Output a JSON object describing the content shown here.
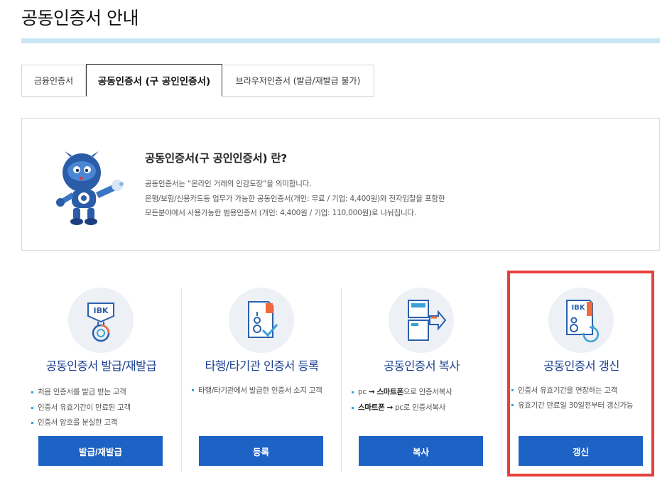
{
  "page_title": "공동인증서 안내",
  "tabs": [
    {
      "label": "금융인증서",
      "active": false
    },
    {
      "label": "공동인증서 (구 공인인증서)",
      "active": true
    },
    {
      "label": "브라우저인증서 (발급/재발급 불가)",
      "active": false
    }
  ],
  "info": {
    "title": "공동인증서(구 공인인증서) 란?",
    "lines": [
      "공동인증서는 “온라인 거래의 인감도장”을 의미합니다.",
      "은행/보험/신용카드등 업무가 가능한 공동인증서(개인: 무료 / 기업: 4,400원)와 전자입찰을 포함한",
      "모든분야에서 사용가능한 범용인증서 (개인: 4,400원 / 기업: 110,000원)로 나눠집니다."
    ]
  },
  "services": [
    {
      "title": "공동인증서 발급/재발급",
      "icon": "certificate-badge-icon",
      "bullets": [
        "처음 인증서를 발급 받는 고객",
        "인증서 유효기간이 만료된 고객",
        "인증서 암호를 분실한 고객"
      ],
      "button": "발급/재발급"
    },
    {
      "title": "타행/타기관 인증서 등록",
      "icon": "certificate-register-icon",
      "bullets": [
        "타행/타기관에서 발급한 인증서 소지 고객"
      ],
      "button": "등록"
    },
    {
      "title": "공동인증서 복사",
      "icon": "certificate-copy-icon",
      "bullets_rich": [
        {
          "a": "pc",
          "arrow": "→",
          "b": "스마트폰",
          "rest": "으로 인증서복사"
        },
        {
          "a": "스마트폰",
          "arrow": "→",
          "b": "pc",
          "rest": "로 인증서복사"
        }
      ],
      "button": "복사"
    },
    {
      "title": "공동인증서 갱신",
      "icon": "certificate-renew-icon",
      "bullets": [
        "인증서 유효기간을 연장하는 고객",
        "유효기간 만료일 30일전부터 갱신가능"
      ],
      "button": "갱신"
    }
  ],
  "icon_text": {
    "ibk": "IBK"
  },
  "colors": {
    "brand_blue": "#1d62c5",
    "title_blue": "#1a3f8f",
    "highlight": "#e8403c",
    "accent_orange": "#f26a3a"
  }
}
